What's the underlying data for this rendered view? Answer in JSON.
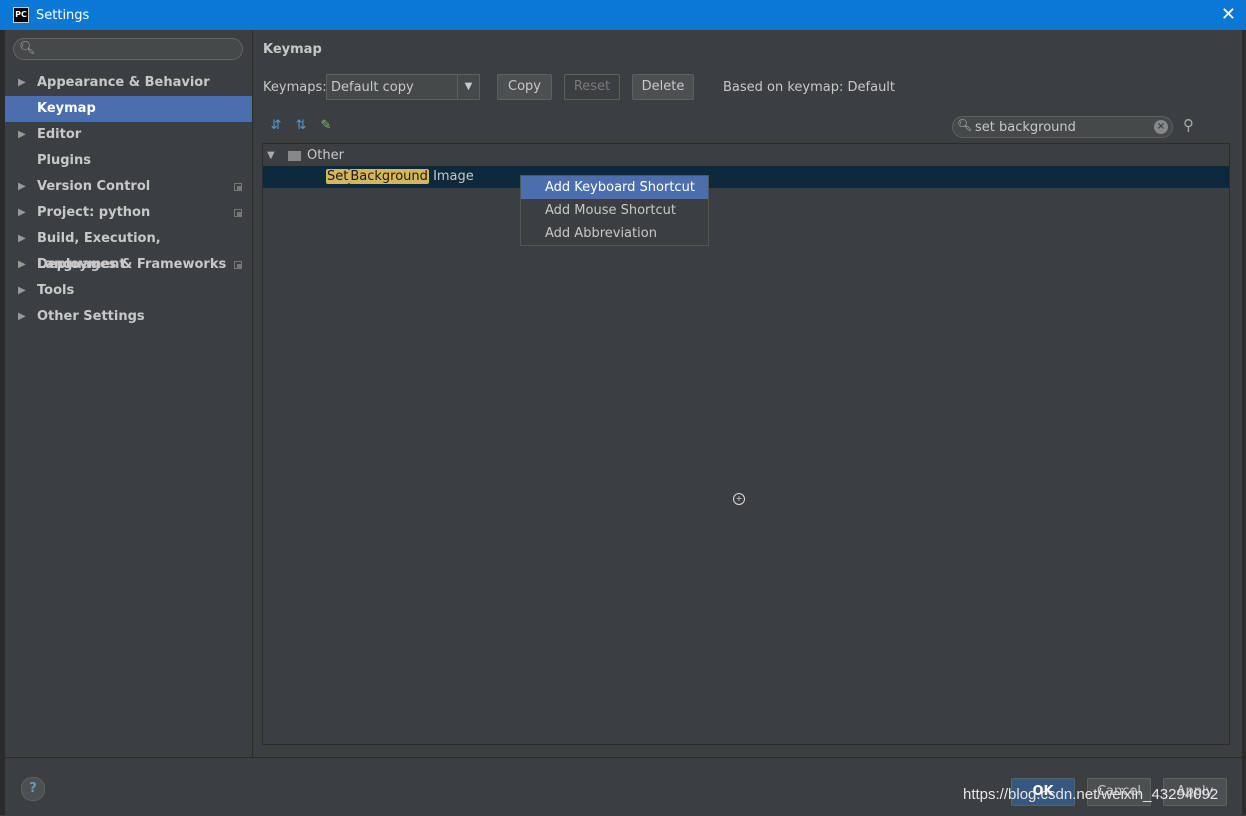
{
  "window": {
    "title": "Settings",
    "app_icon": "PC",
    "close_glyph": "✕"
  },
  "sidebar": {
    "search_placeholder": "",
    "items": [
      {
        "label": "Appearance & Behavior",
        "expandable": true,
        "badge": false
      },
      {
        "label": "Keymap",
        "expandable": false,
        "badge": false,
        "selected": true
      },
      {
        "label": "Editor",
        "expandable": true,
        "badge": false
      },
      {
        "label": "Plugins",
        "expandable": false,
        "badge": false
      },
      {
        "label": "Version Control",
        "expandable": true,
        "badge": true
      },
      {
        "label": "Project: python",
        "expandable": true,
        "badge": true
      },
      {
        "label": "Build, Execution, Deployment",
        "expandable": true,
        "badge": false
      },
      {
        "label": "Languages & Frameworks",
        "expandable": true,
        "badge": true
      },
      {
        "label": "Tools",
        "expandable": true,
        "badge": false
      },
      {
        "label": "Other Settings",
        "expandable": true,
        "badge": false
      }
    ]
  },
  "main": {
    "title": "Keymap",
    "keymaps_label": "Keymaps:",
    "keymap_selected": "Default copy",
    "buttons": {
      "copy": "Copy",
      "reset": "Reset",
      "delete": "Delete"
    },
    "based_on": "Based on keymap: Default",
    "filter_value": "set background",
    "tree": {
      "group_label": "Other",
      "action": {
        "hl1": "Set",
        "hl2": "Background",
        "rest": "Image"
      }
    }
  },
  "context_menu": {
    "items": [
      "Add Keyboard Shortcut",
      "Add Mouse Shortcut",
      "Add Abbreviation"
    ],
    "active_index": 0
  },
  "footer": {
    "help": "?",
    "ok": "OK",
    "cancel": "Cancel",
    "apply": "Apply"
  },
  "watermark": "https://blog.csdn.net/weixin_43294092",
  "colors": {
    "accent": "#4b6eaf",
    "titlebar": "#0a78d7",
    "background": "#3c3f41",
    "highlight": "#d6b656",
    "selected_row": "#0d293e"
  }
}
